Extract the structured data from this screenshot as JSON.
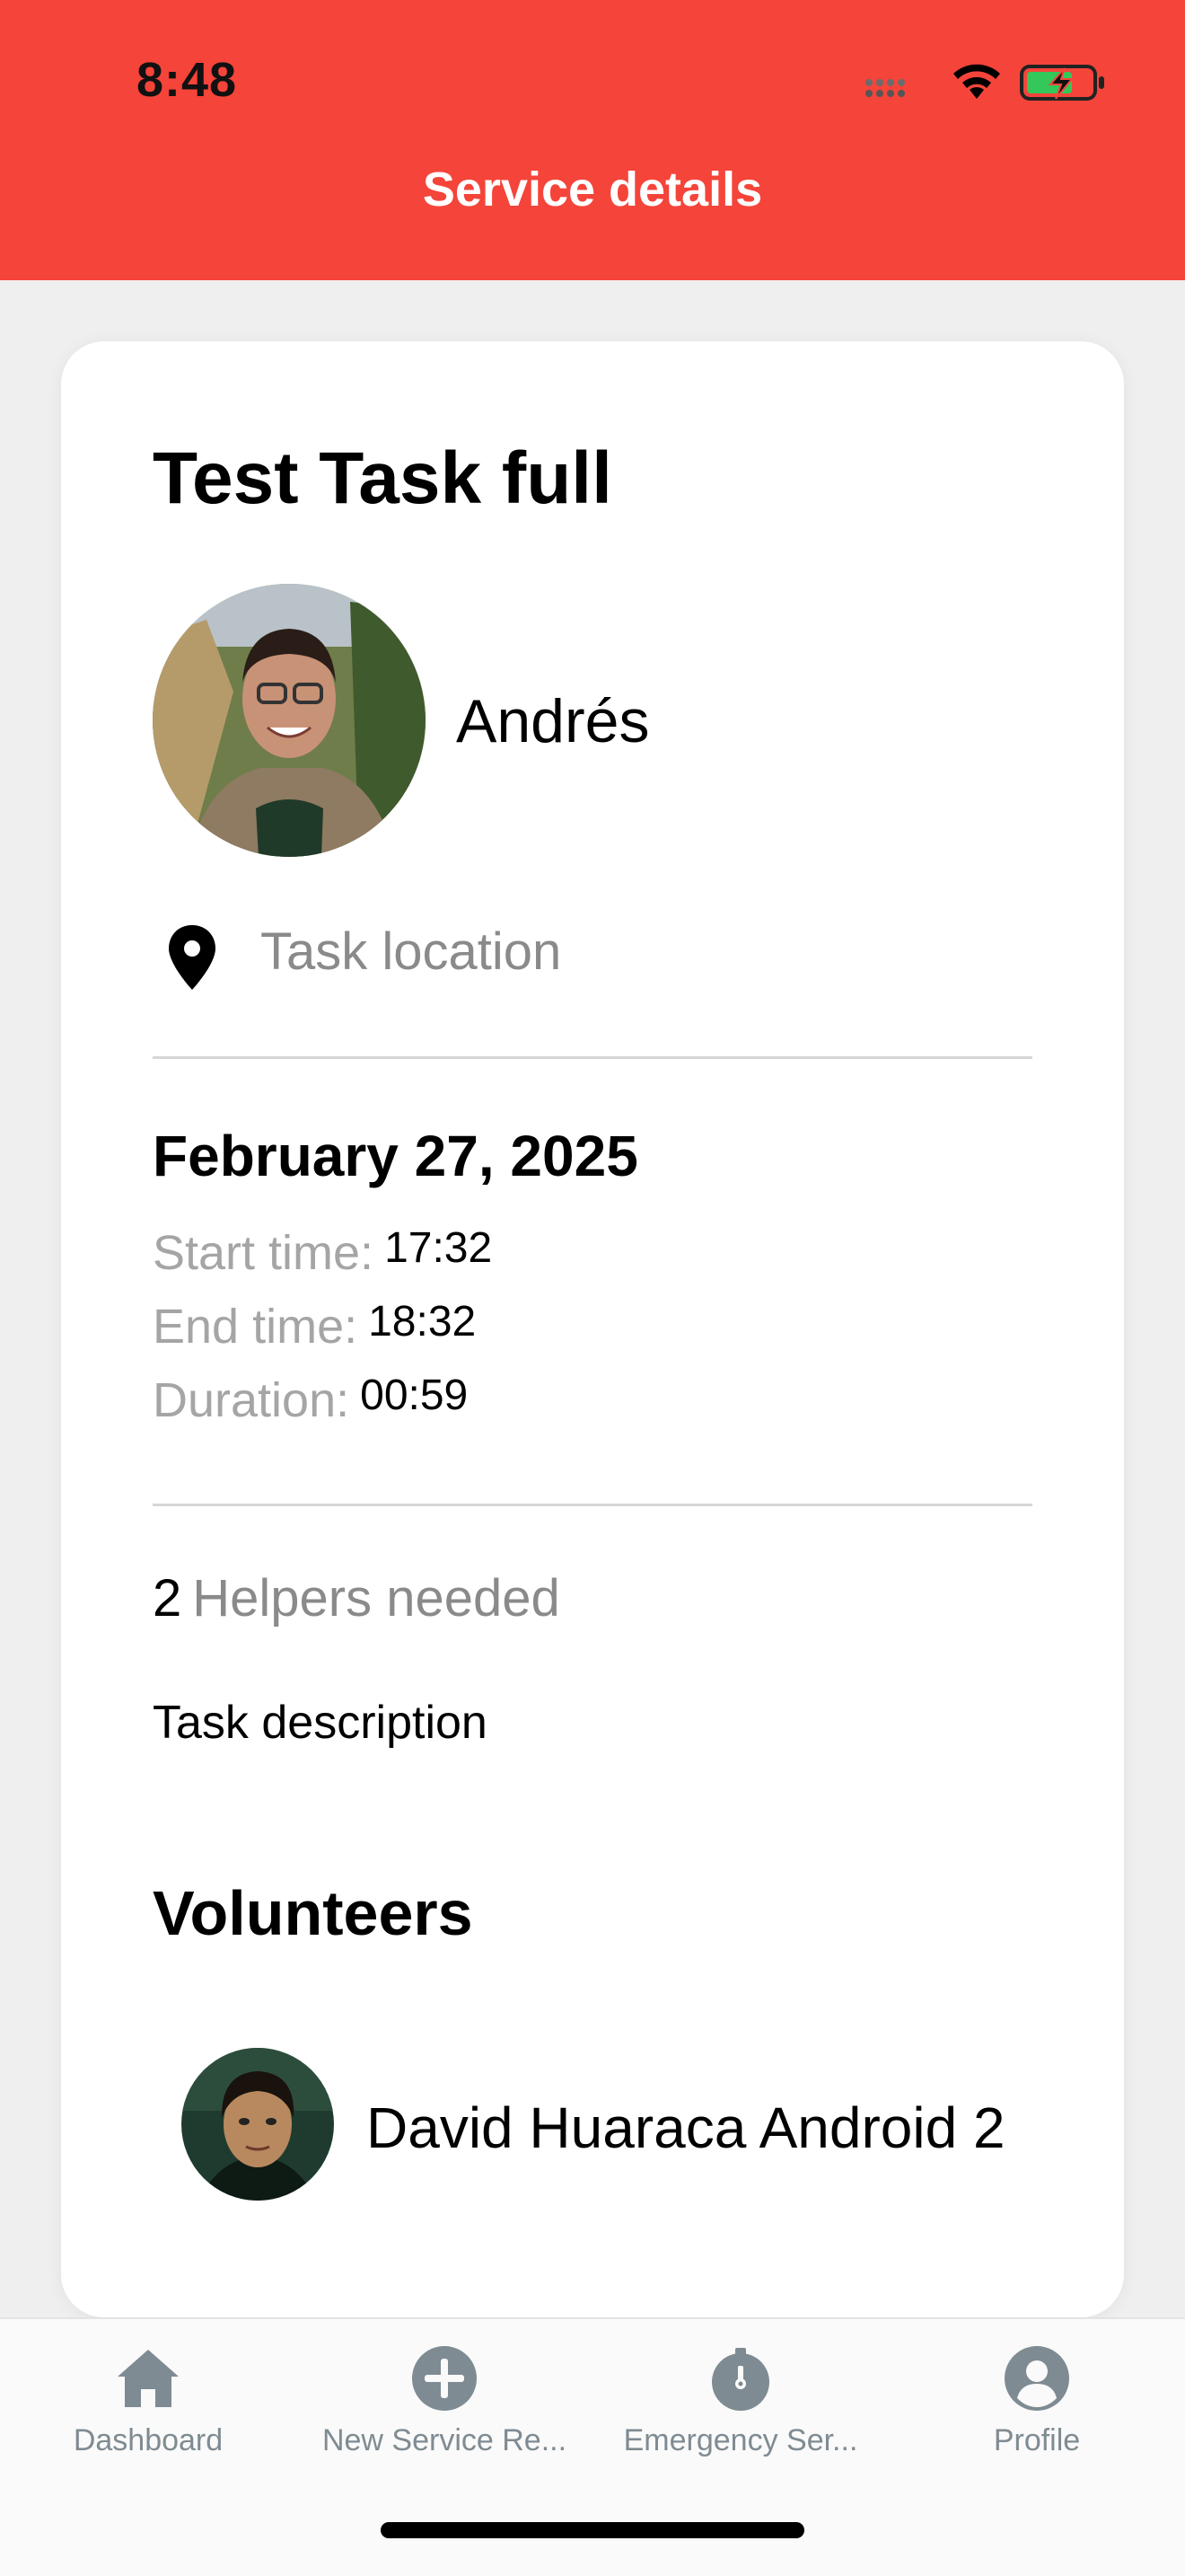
{
  "status_bar": {
    "time": "8:48"
  },
  "header": {
    "title": "Service details"
  },
  "task": {
    "title": "Test Task full",
    "owner_name": "Andrés",
    "location": "Task location",
    "date": "February 27, 2025",
    "start_label": "Start time:",
    "start_value": "17:32",
    "end_label": "End time:",
    "end_value": "18:32",
    "duration_label": "Duration:",
    "duration_value": "00:59",
    "helpers_count": "2",
    "helpers_text": "Helpers needed",
    "description": "Task description"
  },
  "volunteers": {
    "heading": "Volunteers",
    "items": [
      {
        "name": "David Huaraca Android 2"
      }
    ]
  },
  "bottom_nav": {
    "items": [
      {
        "label": "Dashboard",
        "icon": "home-icon"
      },
      {
        "label": "New Service Re...",
        "icon": "plus-circle-icon"
      },
      {
        "label": "Emergency Ser...",
        "icon": "stopwatch-icon"
      },
      {
        "label": "Profile",
        "icon": "user-circle-icon"
      }
    ]
  },
  "colors": {
    "header_bg": "#f5443a",
    "nav_icon": "#7f8b92",
    "muted_text": "#8a8a8a"
  }
}
